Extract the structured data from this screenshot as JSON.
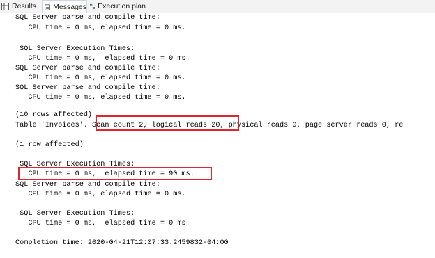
{
  "tabs": [
    {
      "label": "Results",
      "icon": "results-grid-icon"
    },
    {
      "label": "Messages",
      "icon": "messages-icon"
    },
    {
      "label": "Execution plan",
      "icon": "execution-plan-icon"
    }
  ],
  "active_tab": "Messages",
  "messages": [
    "SQL Server parse and compile time:",
    "   CPU time = 0 ms, elapsed time = 0 ms.",
    "",
    " SQL Server Execution Times:",
    "   CPU time = 0 ms,  elapsed time = 0 ms.",
    "SQL Server parse and compile time:",
    "   CPU time = 0 ms, elapsed time = 0 ms.",
    "SQL Server parse and compile time:",
    "   CPU time = 0 ms, elapsed time = 0 ms.",
    "",
    "(10 rows affected)",
    "Table 'Invoices'. Scan count 2, logical reads 20, physical reads 0, page server reads 0, re",
    "",
    "(1 row affected)",
    "",
    " SQL Server Execution Times:",
    "   CPU time = 0 ms,  elapsed time = 90 ms.",
    "SQL Server parse and compile time:",
    "   CPU time = 0 ms, elapsed time = 0 ms.",
    "",
    " SQL Server Execution Times:",
    "   CPU time = 0 ms,  elapsed time = 0 ms.",
    "",
    "Completion time: 2020-04-21T12:07:33.2459832-04:00"
  ],
  "colors": {
    "highlight_border": "#e0252f",
    "tab_border": "#cfd6e2"
  }
}
